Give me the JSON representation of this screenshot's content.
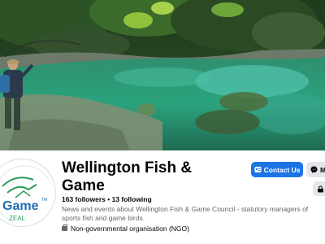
{
  "page": {
    "name": "Wellington Fish & Game",
    "followers": "163 followers",
    "separator": " • ",
    "following": "13 following",
    "description": "News and events about Wellington Fish & Game Council - statutory managers of sports fish and game birds.",
    "category": "Non-governmental organisation (NGO)"
  },
  "actions": {
    "contact_label": "Contact Us",
    "message_label": "M"
  },
  "logo": {
    "text": "Game",
    "tm": "TM",
    "sub": "ZEAL",
    "brand_color": "#1f6fb2",
    "accent_color": "#2e9e5b"
  },
  "colors": {
    "primary_button": "#1b74e4",
    "secondary_button": "#e4e6eb",
    "secondary_text": "#65676b"
  }
}
